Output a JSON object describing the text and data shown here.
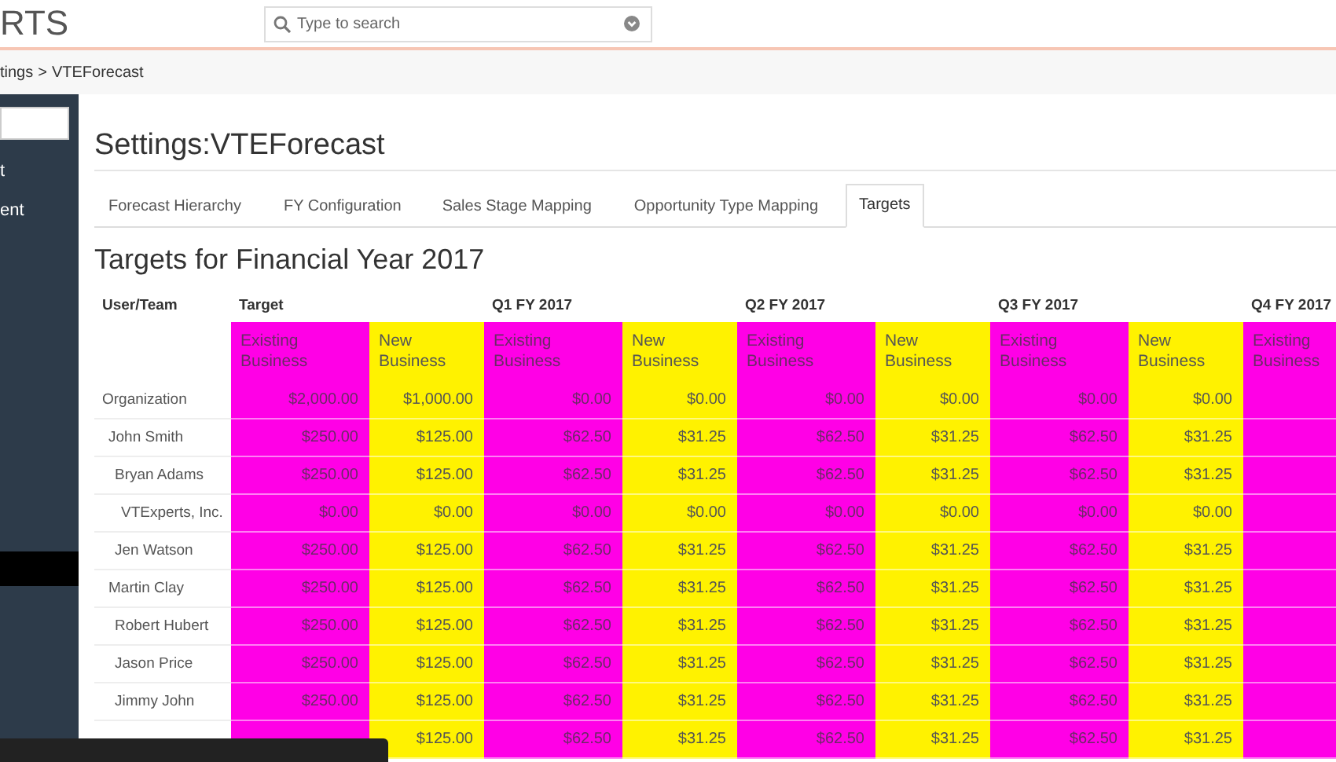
{
  "topbar": {
    "logo": "RTS",
    "search": {
      "placeholder": "Type to search"
    }
  },
  "breadcrumb": {
    "crumbs": [
      "tings",
      "VTEForecast"
    ],
    "separator": ">"
  },
  "sidebar": {
    "items": [
      {
        "label": "t"
      },
      {
        "label": "ent"
      }
    ]
  },
  "page_title": "Settings:VTEForecast",
  "tabs": [
    {
      "label": "Forecast Hierarchy",
      "selected": false
    },
    {
      "label": "FY Configuration",
      "selected": false
    },
    {
      "label": "Sales Stage Mapping",
      "selected": false
    },
    {
      "label": "Opportunity Type Mapping",
      "selected": false
    },
    {
      "label": "Targets",
      "selected": true
    }
  ],
  "section_title": "Targets for Financial Year 2017",
  "table": {
    "first_column": "User/Team",
    "groups": [
      {
        "label": "Target",
        "columns": [
          {
            "label": "Existing Business",
            "color": "#ff00e6"
          },
          {
            "label": "New Business",
            "color": "#fff200"
          }
        ]
      },
      {
        "label": "Q1 FY 2017",
        "columns": [
          {
            "label": "Existing Business",
            "color": "#ff00e6"
          },
          {
            "label": "New Business",
            "color": "#fff200"
          }
        ]
      },
      {
        "label": "Q2 FY 2017",
        "columns": [
          {
            "label": "Existing Business",
            "color": "#ff00e6"
          },
          {
            "label": "New Business",
            "color": "#fff200"
          }
        ]
      },
      {
        "label": "Q3 FY 2017",
        "columns": [
          {
            "label": "Existing Business",
            "color": "#ff00e6"
          },
          {
            "label": "New Business",
            "color": "#fff200"
          }
        ]
      },
      {
        "label": "Q4 FY 2017",
        "columns": [
          {
            "label": "Existing Business",
            "color": "#ff00e6"
          }
        ]
      }
    ],
    "rows": [
      {
        "user": "Organization",
        "cells": [
          "$2,000.00",
          "$1,000.00",
          "$0.00",
          "$0.00",
          "$0.00",
          "$0.00",
          "$0.00",
          "$0.00"
        ],
        "children": [
          {
            "user": "John Smith",
            "cells": [
              "$250.00",
              "$125.00",
              "$62.50",
              "$31.25",
              "$62.50",
              "$31.25",
              "$62.50",
              "$31.25"
            ],
            "children": [
              {
                "user": "Bryan Adams",
                "cells": [
                  "$250.00",
                  "$125.00",
                  "$62.50",
                  "$31.25",
                  "$62.50",
                  "$31.25",
                  "$62.50",
                  "$31.25"
                ],
                "children": [
                  {
                    "user": "VTExperts, Inc.",
                    "cells": [
                      "$0.00",
                      "$0.00",
                      "$0.00",
                      "$0.00",
                      "$0.00",
                      "$0.00",
                      "$0.00",
                      "$0.00"
                    ]
                  }
                ]
              },
              {
                "user": "Jen Watson",
                "cells": [
                  "$250.00",
                  "$125.00",
                  "$62.50",
                  "$31.25",
                  "$62.50",
                  "$31.25",
                  "$62.50",
                  "$31.25"
                ]
              }
            ]
          },
          {
            "user": "Martin Clay",
            "cells": [
              "$250.00",
              "$125.00",
              "$62.50",
              "$31.25",
              "$62.50",
              "$31.25",
              "$62.50",
              "$31.25"
            ],
            "children": [
              {
                "user": "Robert Hubert",
                "cells": [
                  "$250.00",
                  "$125.00",
                  "$62.50",
                  "$31.25",
                  "$62.50",
                  "$31.25",
                  "$62.50",
                  "$31.25"
                ]
              },
              {
                "user": "Jason Price",
                "cells": [
                  "$250.00",
                  "$125.00",
                  "$62.50",
                  "$31.25",
                  "$62.50",
                  "$31.25",
                  "$62.50",
                  "$31.25"
                ]
              },
              {
                "user": "Jimmy John",
                "cells": [
                  "$250.00",
                  "$125.00",
                  "$62.50",
                  "$31.25",
                  "$62.50",
                  "$31.25",
                  "$62.50",
                  "$31.25"
                ]
              },
              {
                "cells": [
                  null,
                  "$125.00",
                  "$62.50",
                  "$31.25",
                  "$62.50",
                  "$31.25",
                  "$62.50",
                  "$31.25"
                ]
              }
            ]
          }
        ]
      }
    ]
  }
}
